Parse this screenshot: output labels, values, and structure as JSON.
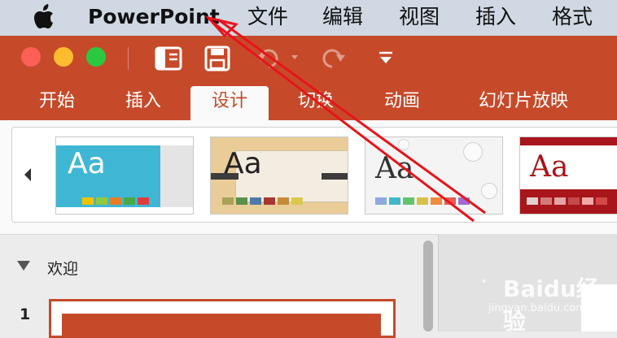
{
  "menubar": {
    "apple_icon": "apple-logo",
    "app_name": "PowerPoint",
    "items": [
      "文件",
      "编辑",
      "视图",
      "插入",
      "格式"
    ]
  },
  "window": {
    "traffic_lights": [
      "close",
      "minimize",
      "zoom"
    ],
    "quick_access_icons": [
      "slide-panel-icon",
      "save-icon",
      "undo-icon",
      "redo-icon",
      "customize-icon"
    ]
  },
  "ribbon": {
    "tabs": [
      "开始",
      "插入",
      "设计",
      "切换",
      "动画",
      "幻灯片放映"
    ],
    "active_tab": "设计",
    "accent_color": "#c64a2a"
  },
  "gallery": {
    "themes": [
      {
        "label": "Aa"
      },
      {
        "label": "Aa"
      },
      {
        "label": "Aa"
      },
      {
        "label": "Aa"
      }
    ]
  },
  "slides_panel": {
    "section_label": "欢迎",
    "slide_number": "1"
  },
  "watermark": {
    "text": "Baidu经验",
    "sub": "jingyan.baidu.com"
  }
}
